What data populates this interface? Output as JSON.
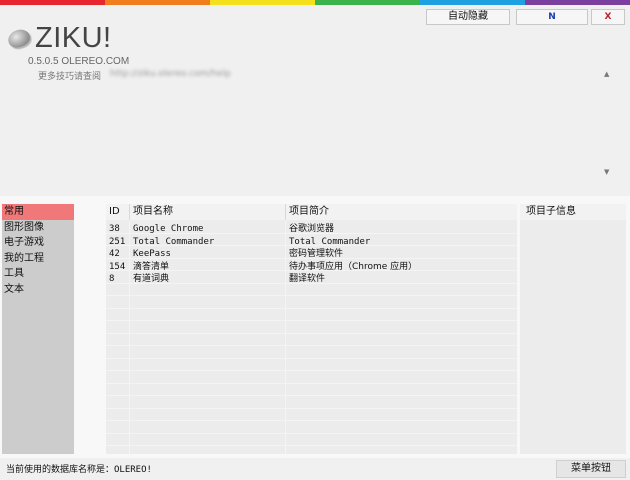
{
  "colors": {
    "rainbow": [
      "#e8262d",
      "#f07e1f",
      "#f5e01e",
      "#3cb34a",
      "#1fa0e0",
      "#7b3fa0"
    ],
    "active_category": "#f07878",
    "minimize_glyph": "#1a3db0",
    "close_glyph": "#c0202a"
  },
  "window_buttons": {
    "autohide": "自动隐藏",
    "minimize": "N",
    "close": "X"
  },
  "header": {
    "logo_icon": "stone-icon",
    "app_name": "ZIKU!",
    "version": "0.5.0.5  OLEREO.COM",
    "more_tips": "更多技巧请查阅",
    "blurred_url": "http://ziku.olereo.com/help"
  },
  "categories": [
    {
      "label": "常用",
      "active": true
    },
    {
      "label": "图形图像",
      "active": false
    },
    {
      "label": "电子游戏",
      "active": false
    },
    {
      "label": "我的工程",
      "active": false
    },
    {
      "label": "工具",
      "active": false
    },
    {
      "label": "文本",
      "active": false
    }
  ],
  "table": {
    "columns": [
      "ID",
      "项目名称",
      "项目简介"
    ],
    "rows": [
      {
        "id": "38",
        "name": "Google Chrome",
        "desc": "谷歌浏览器"
      },
      {
        "id": "251",
        "name": "Total Commander",
        "desc": "Total Commander"
      },
      {
        "id": "42",
        "name": "KeePass",
        "desc": "密码管理软件"
      },
      {
        "id": "154",
        "name": "滴答清单",
        "desc": "待办事项应用（Chrome 应用）"
      },
      {
        "id": "8",
        "name": "有道词典",
        "desc": "翻译软件"
      }
    ]
  },
  "sub_info": {
    "header": "项目子信息"
  },
  "status": {
    "text": "当前使用的数据库名称是：OLEREO!"
  },
  "menu_button": {
    "label": "菜单按钮"
  }
}
